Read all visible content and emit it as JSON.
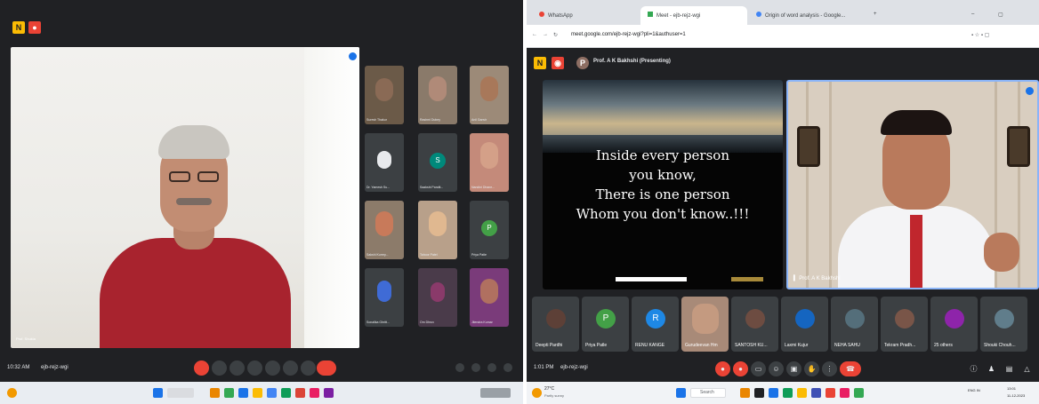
{
  "left_meet": {
    "meeting_time": "10:32 AM",
    "meeting_code": "ejb-rejz-wgi",
    "tiles": [
      {
        "name": "Suresh Thakur"
      },
      {
        "name": "Rashmi Dubey"
      },
      {
        "name": "Anil Ganvir"
      },
      {
        "name": "Dr. Yamesh Su..."
      },
      {
        "name": "Saakshi Pandit...",
        "initial": "S"
      },
      {
        "name": "Nandini Dhane..."
      },
      {
        "name": "Sakshi Kurrey..."
      },
      {
        "name": "Tahoor Patel"
      },
      {
        "name": "Priya Patle",
        "initial": "P"
      },
      {
        "name": "Sonalika Ghritt..."
      },
      {
        "name": "Om Dhruv"
      },
      {
        "name": "Jitendra Kumar"
      }
    ],
    "main_video_label": "Prof. Shukla"
  },
  "right_browser": {
    "tabs": [
      {
        "label": "WhatsApp"
      },
      {
        "label": "Meet - ejb-rejz-wgi"
      },
      {
        "label": "Origin of word analysis - Google..."
      }
    ],
    "url": "meet.google.com/ejb-rejz-wgi?pli=1&authuser=1",
    "presenting": "Prof. A K Bakhshi (Presenting)",
    "slide_lines": [
      "Inside every person",
      "you know,",
      "There is one person",
      "Whom you don't know..!!!"
    ],
    "speaker_label": "Prof. A K Bakhshi",
    "participants": [
      {
        "name": "Deepti Pardhi"
      },
      {
        "name": "Priya Patle",
        "initial": "P"
      },
      {
        "name": "RENU KANGE",
        "initial": "R"
      },
      {
        "name": "Gurudeevan Hm"
      },
      {
        "name": "SANTOSH KU..."
      },
      {
        "name": "Laxmi Kujur"
      },
      {
        "name": "NEHA SAHU"
      },
      {
        "name": "Tekram Pradh..."
      },
      {
        "name": "25 others"
      },
      {
        "name": "Shouki Chouh..."
      }
    ],
    "meeting_time": "1:01 PM",
    "meeting_code": "ejb-rejz-wgi",
    "taskbar_search": "Search",
    "weather": "27°C",
    "weather_sub": "Partly sunny",
    "clock_time": "13:01",
    "clock_date": "11-12-2023",
    "lang": "ENG IN"
  },
  "colors": {
    "meet_bg": "#202124",
    "tile_bg": "#3c4043",
    "end_call": "#ea4335",
    "accent": "#8ab4f8"
  }
}
